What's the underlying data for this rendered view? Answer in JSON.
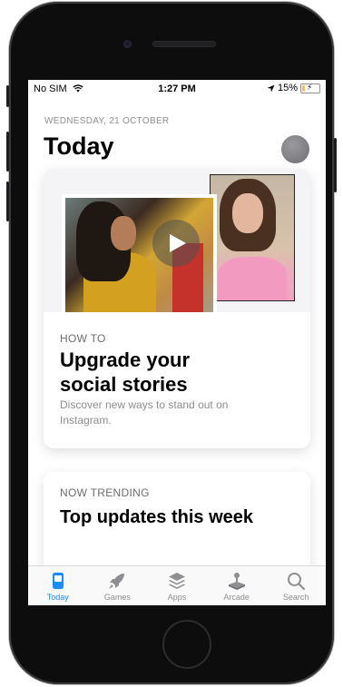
{
  "statusbar": {
    "carrier": "No SIM",
    "time": "1:27 PM",
    "battery": "15%",
    "battery_level": 0.15
  },
  "header": {
    "date": "WEDNESDAY, 21 OCTOBER",
    "title": "Today"
  },
  "cards": [
    {
      "eyebrow": "HOW TO",
      "title_line1": "Upgrade your",
      "title_line2": "social stories",
      "description": "Discover new ways to stand out on Instagram."
    },
    {
      "eyebrow": "NOW TRENDING",
      "title": "Top updates this week"
    }
  ],
  "tabs": [
    {
      "label": "Today",
      "icon": "today-icon",
      "active": true
    },
    {
      "label": "Games",
      "icon": "rocket-icon",
      "active": false
    },
    {
      "label": "Apps",
      "icon": "layers-icon",
      "active": false
    },
    {
      "label": "Arcade",
      "icon": "joystick-icon",
      "active": false
    },
    {
      "label": "Search",
      "icon": "search-icon",
      "active": false
    }
  ],
  "colors": {
    "accent": "#1a8cff",
    "inactive": "#8e8e93",
    "battery": "#f7c531"
  }
}
